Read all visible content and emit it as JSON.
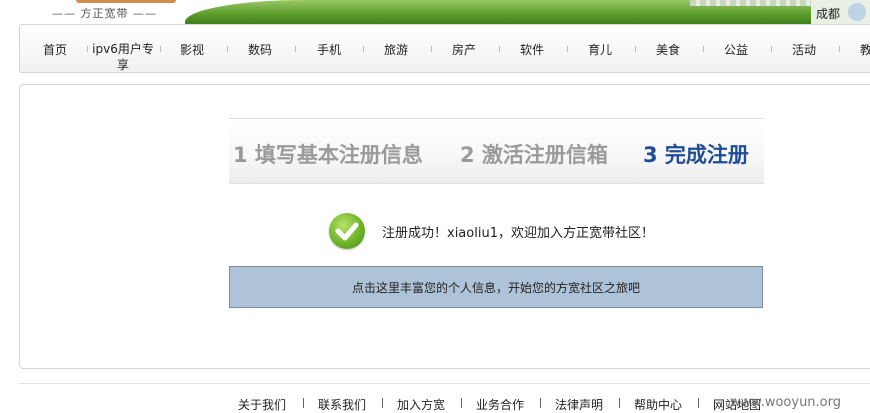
{
  "banner": {
    "logo_subtitle": "—— 方正宽带 ——",
    "city": "成都"
  },
  "nav": {
    "items": [
      {
        "label": "首页"
      },
      {
        "label": "ipv6用户专享"
      },
      {
        "label": "影视"
      },
      {
        "label": "数码"
      },
      {
        "label": "手机"
      },
      {
        "label": "旅游"
      },
      {
        "label": "房产"
      },
      {
        "label": "软件"
      },
      {
        "label": "育儿"
      },
      {
        "label": "美食"
      },
      {
        "label": "公益"
      },
      {
        "label": "活动"
      },
      {
        "label": "教"
      }
    ]
  },
  "steps": [
    {
      "label": "1 填写基本注册信息",
      "state": "done"
    },
    {
      "label": "2 激活注册信箱",
      "state": "done"
    },
    {
      "label": "3 完成注册",
      "state": "active"
    }
  ],
  "colors": {
    "active_step": "#1d4d98",
    "inactive_step": "#9a9a9a",
    "cta_background": "#aec3d8",
    "success_green": "#6fb42a"
  },
  "message": {
    "icon": "checkmark-icon",
    "text": "注册成功！xiaoliu1，欢迎加入方正宽带社区！"
  },
  "cta": {
    "label": "点击这里丰富您的个人信息，开始您的方宽社区之旅吧"
  },
  "footer": {
    "links": [
      {
        "label": "关于我们"
      },
      {
        "label": "联系我们"
      },
      {
        "label": "加入方宽"
      },
      {
        "label": "业务合作"
      },
      {
        "label": "法律声明"
      },
      {
        "label": "帮助中心"
      },
      {
        "label": "网站地图"
      }
    ],
    "watermark": "www.wooyun.org"
  }
}
